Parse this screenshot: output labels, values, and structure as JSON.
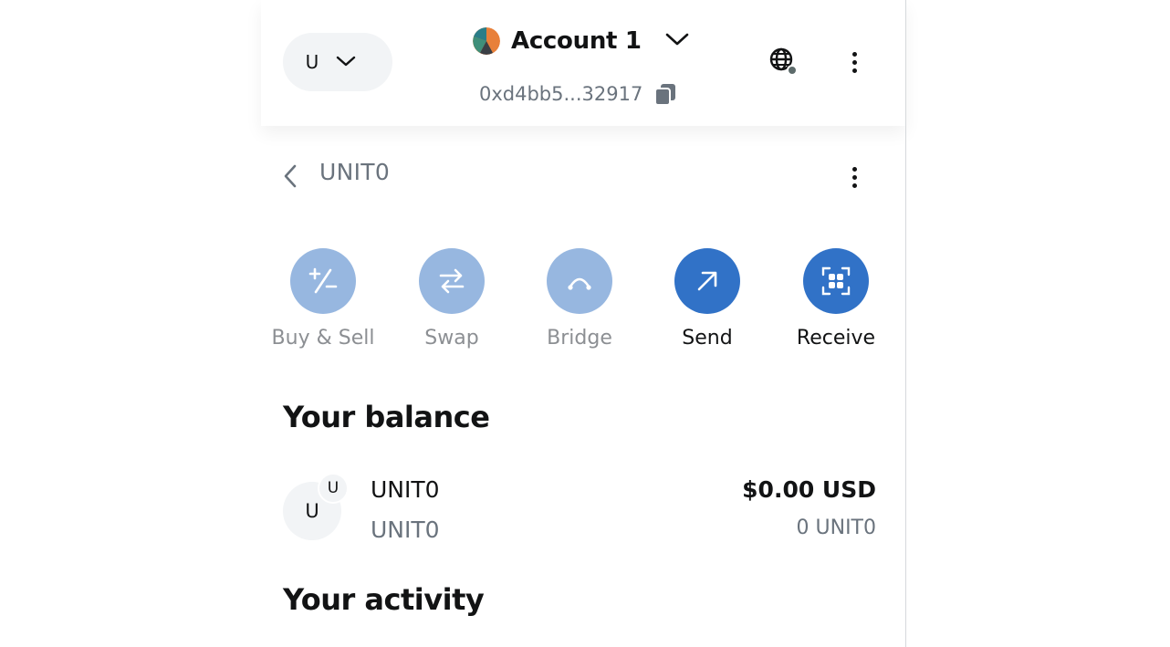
{
  "header": {
    "network_letter": "U",
    "account_name": "Account 1",
    "address": "0xd4bb5...32917"
  },
  "token_header": {
    "title": "UNIT0"
  },
  "actions": [
    {
      "label": "Buy & Sell",
      "icon": "buy-sell-icon",
      "enabled": false
    },
    {
      "label": "Swap",
      "icon": "swap-icon",
      "enabled": false
    },
    {
      "label": "Bridge",
      "icon": "bridge-icon",
      "enabled": false
    },
    {
      "label": "Send",
      "icon": "send-arrow-icon",
      "enabled": true
    },
    {
      "label": "Receive",
      "icon": "qr-code-icon",
      "enabled": true
    }
  ],
  "balance": {
    "title": "Your balance",
    "token": {
      "icon_letter": "U",
      "badge_letter": "U",
      "name": "UNIT0",
      "subtitle": "UNIT0",
      "fiat_value": "$0.00 USD",
      "amount": "0 UNIT0"
    }
  },
  "activity": {
    "title": "Your activity"
  },
  "colors": {
    "accent": "#3172c7",
    "accent_disabled": "#97b7e0",
    "muted_text": "#6a737d",
    "pill_background": "#f2f4f6"
  }
}
